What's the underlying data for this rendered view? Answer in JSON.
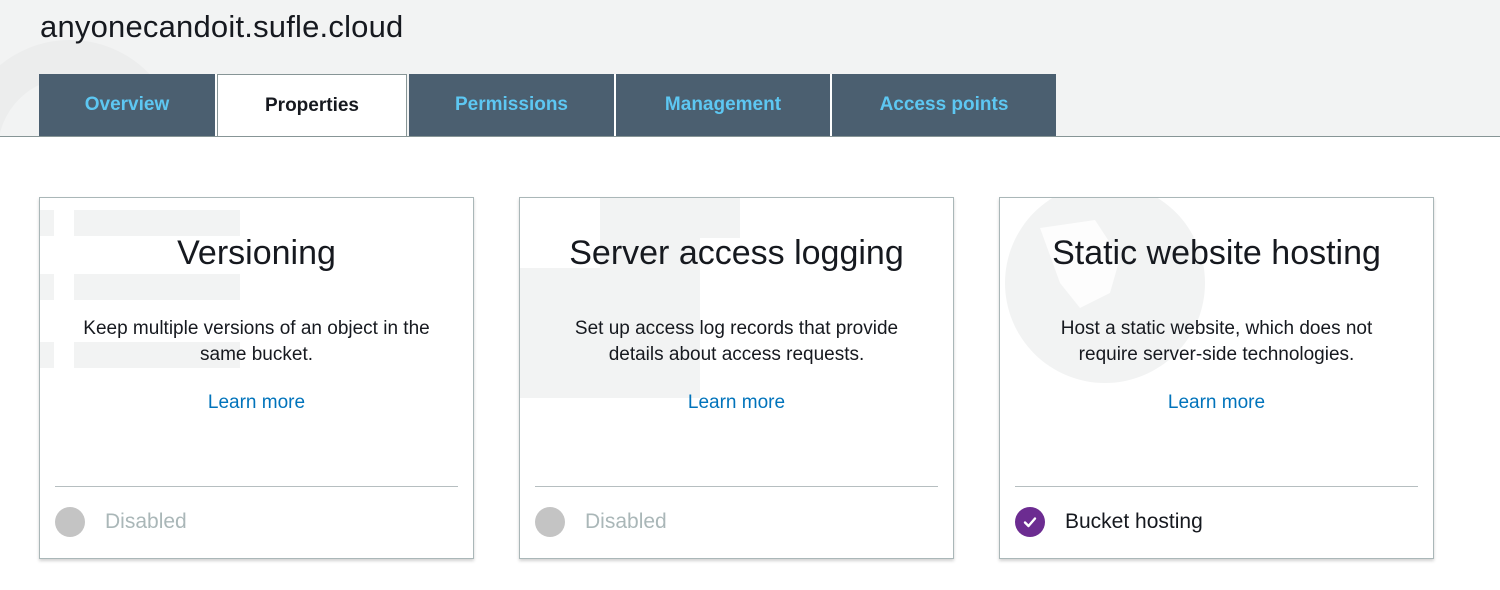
{
  "bucket": {
    "name": "anyonecandoit.sufle.cloud"
  },
  "tabs": [
    {
      "label": "Overview",
      "active": false
    },
    {
      "label": "Properties",
      "active": true
    },
    {
      "label": "Permissions",
      "active": false
    },
    {
      "label": "Management",
      "active": false
    },
    {
      "label": "Access points",
      "active": false
    }
  ],
  "cards": [
    {
      "title": "Versioning",
      "description": "Keep multiple versions of an object in the same bucket.",
      "link": "Learn more",
      "status": "Disabled",
      "enabled": false,
      "watermark_icon": "list-icon"
    },
    {
      "title": "Server access logging",
      "description": "Set up access log records that provide details about access requests.",
      "link": "Learn more",
      "status": "Disabled",
      "enabled": false,
      "watermark_icon": "document-icon"
    },
    {
      "title": "Static website hosting",
      "description": "Host a static website, which does not require server-side technologies.",
      "link": "Learn more",
      "status": "Bucket hosting",
      "enabled": true,
      "watermark_icon": "globe-icon"
    }
  ],
  "colors": {
    "tab_background": "#4b5f70",
    "tab_text": "#5dc7f2",
    "link": "#0073bb",
    "enabled_status": "#6c2c91",
    "disabled_status": "#c4c4c4"
  }
}
